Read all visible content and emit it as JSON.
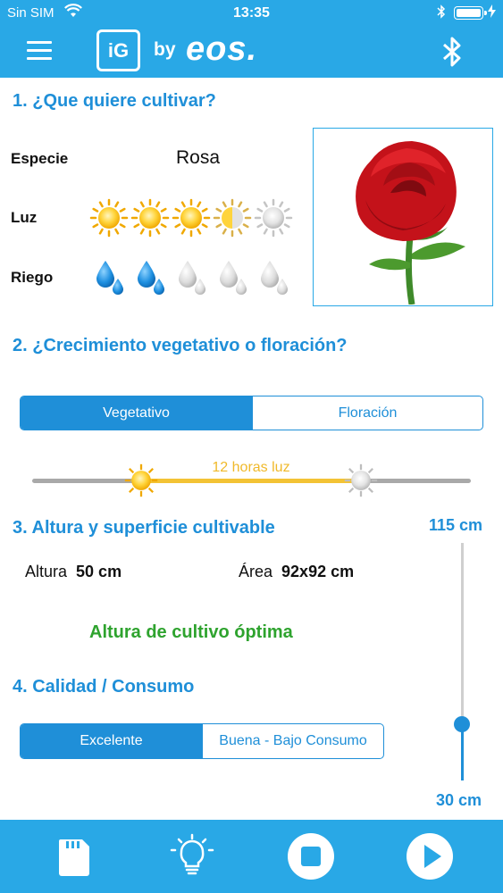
{
  "status_bar": {
    "carrier": "Sin SIM",
    "time": "13:35",
    "icons": [
      "wifi-icon",
      "bluetooth-icon",
      "battery-icon",
      "charging-icon"
    ]
  },
  "app_bar": {
    "logo_mark": "iG",
    "logo_by": "by",
    "logo_brand": "eos.",
    "icons": [
      "menu-icon",
      "bluetooth-icon"
    ]
  },
  "section1": {
    "title": "1. ¿Que quiere cultivar?",
    "species_label": "Especie",
    "species_value": "Rosa",
    "light_label": "Luz",
    "light_level": 3.5,
    "light_max": 5,
    "water_label": "Riego",
    "water_level": 2,
    "water_max": 5,
    "image": "rose-image"
  },
  "section2": {
    "title": "2. ¿Crecimiento vegetativo o floración?",
    "options": [
      "Vegetativo",
      "Floración"
    ],
    "selected": "Vegetativo",
    "hours_label": "12 horas luz"
  },
  "section3": {
    "title": "3. Altura y superficie cultivable",
    "height_label": "Altura",
    "height_value": "50 cm",
    "area_label": "Área",
    "area_value": "92x92 cm",
    "status": "Altura de cultivo óptima",
    "slider_max_label": "115 cm",
    "slider_min_label": "30 cm",
    "slider_fraction": 0.24
  },
  "section4": {
    "title": "4. Calidad / Consumo",
    "options": [
      "Excelente",
      "Buena - Bajo Consumo"
    ],
    "selected": "Excelente"
  },
  "bottom_bar": {
    "icons": [
      "sd-card-icon",
      "lightbulb-icon",
      "stop-icon",
      "play-icon"
    ]
  },
  "colors": {
    "primary": "#29a8e6",
    "accent_blue": "#1f8fd8",
    "sun_yellow": "#f3c335",
    "optimal_green": "#2ea32e",
    "grey": "#a9a9a9"
  }
}
